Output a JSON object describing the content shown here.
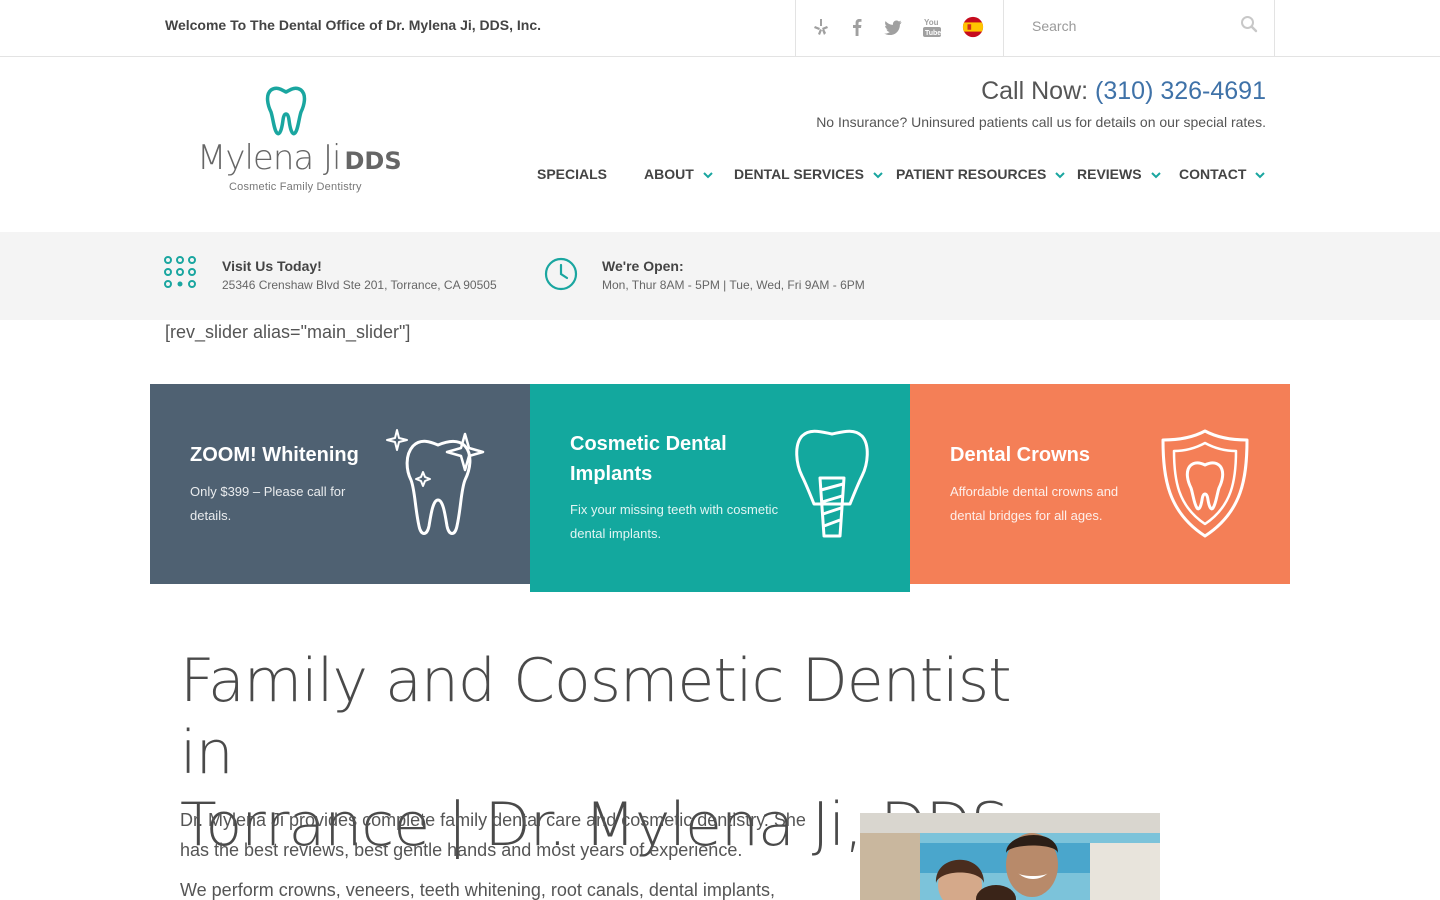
{
  "topbar": {
    "welcome": "Welcome To The Dental Office of Dr. Mylena Ji, DDS, Inc.",
    "social_icons": [
      "yelp-icon",
      "facebook-icon",
      "twitter-icon",
      "youtube-icon",
      "spain-flag-icon"
    ],
    "search_placeholder": "Search"
  },
  "logo": {
    "name": "Mylena Ji",
    "suffix": "DDS",
    "tagline": "Cosmetic Family Dentistry",
    "color": "#1aa6a0"
  },
  "header": {
    "call_label": "Call Now:",
    "phone": "(310) 326-4691",
    "insurance_note": "No Insurance? Uninsured patients call us for details on our special rates."
  },
  "nav": {
    "items": [
      {
        "label": "SPECIALS",
        "dropdown": false
      },
      {
        "label": "ABOUT",
        "dropdown": true
      },
      {
        "label": "DENTAL SERVICES",
        "dropdown": true
      },
      {
        "label": "PATIENT RESOURCES",
        "dropdown": true
      },
      {
        "label": "REVIEWS",
        "dropdown": true
      },
      {
        "label": "CONTACT",
        "dropdown": true
      }
    ],
    "accent": "#1aa6a0"
  },
  "infobar": {
    "visit_title": "Visit Us Today!",
    "visit_address": "25346 Crenshaw Blvd Ste 201, Torrance, CA 90505",
    "open_title": "We're Open:",
    "open_hours": "Mon, Thur 8AM - 5PM | Tue, Wed, Fri 9AM - 6PM"
  },
  "shortcode": "[rev_slider alias=\"main_slider\"]",
  "cards": [
    {
      "title": "ZOOM! Whitening",
      "desc_line1": "Only $399 – Please call for",
      "desc_line2": "details.",
      "color": "#4f6172",
      "icon": "sparkling-tooth-icon"
    },
    {
      "title_line1": "Cosmetic Dental",
      "title_line2": "Implants",
      "desc_line1": "Fix your missing teeth with cosmetic",
      "desc_line2": "dental implants.",
      "color": "#13a89e",
      "icon": "dental-implant-icon"
    },
    {
      "title": "Dental Crowns",
      "desc_line1": "Affordable dental crowns and",
      "desc_line2": "dental bridges for all ages.",
      "color": "#f47f57",
      "icon": "tooth-shield-icon"
    }
  ],
  "main": {
    "heading_line1": "Family and Cosmetic Dentist in",
    "heading_line2": "Torrance | Dr. Mylena Ji, DDS",
    "para1_line1": "Dr. Mylena Ji provides complete family dental care and cosmetic dentistry. She",
    "para1_line2": "has the best reviews, best gentle hands and most years of experience.",
    "para2_line1": "We perform crowns, veneers, teeth whitening, root canals, dental implants,"
  }
}
